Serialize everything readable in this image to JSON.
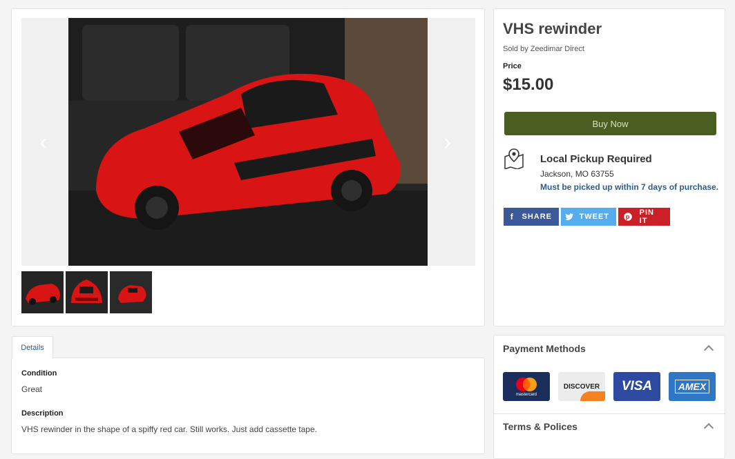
{
  "product": {
    "title": "VHS rewinder",
    "seller": "Sold by Zeedimar Direct",
    "price_label": "Price",
    "price": "$15.00",
    "buy_label": "Buy Now"
  },
  "pickup": {
    "title": "Local Pickup Required",
    "location": "Jackson, MO 63755",
    "note": "Must be picked up within 7 days of purchase."
  },
  "social": {
    "share": "SHARE",
    "tweet": "TWEET",
    "pin": "PIN IT"
  },
  "gallery": {
    "prev_icon": "chevron-left-icon",
    "next_icon": "chevron-right-icon",
    "thumbnail_count": 3
  },
  "details": {
    "tab_label": "Details",
    "condition_label": "Condition",
    "condition_value": "Great",
    "description_label": "Description",
    "description_value": "VHS rewinder in the shape of a spiffy red car. Still works. Just add cassette tape."
  },
  "payment": {
    "heading": "Payment Methods",
    "cards": [
      "mastercard",
      "DISCOVER",
      "VISA",
      "AMEX"
    ],
    "terms_heading": "Terms & Polices"
  },
  "colors": {
    "buy_button": "#4a5e22",
    "link_blue": "#2d5c8f",
    "facebook": "#3b5998",
    "twitter": "#55acee",
    "pinterest": "#cb2027"
  }
}
